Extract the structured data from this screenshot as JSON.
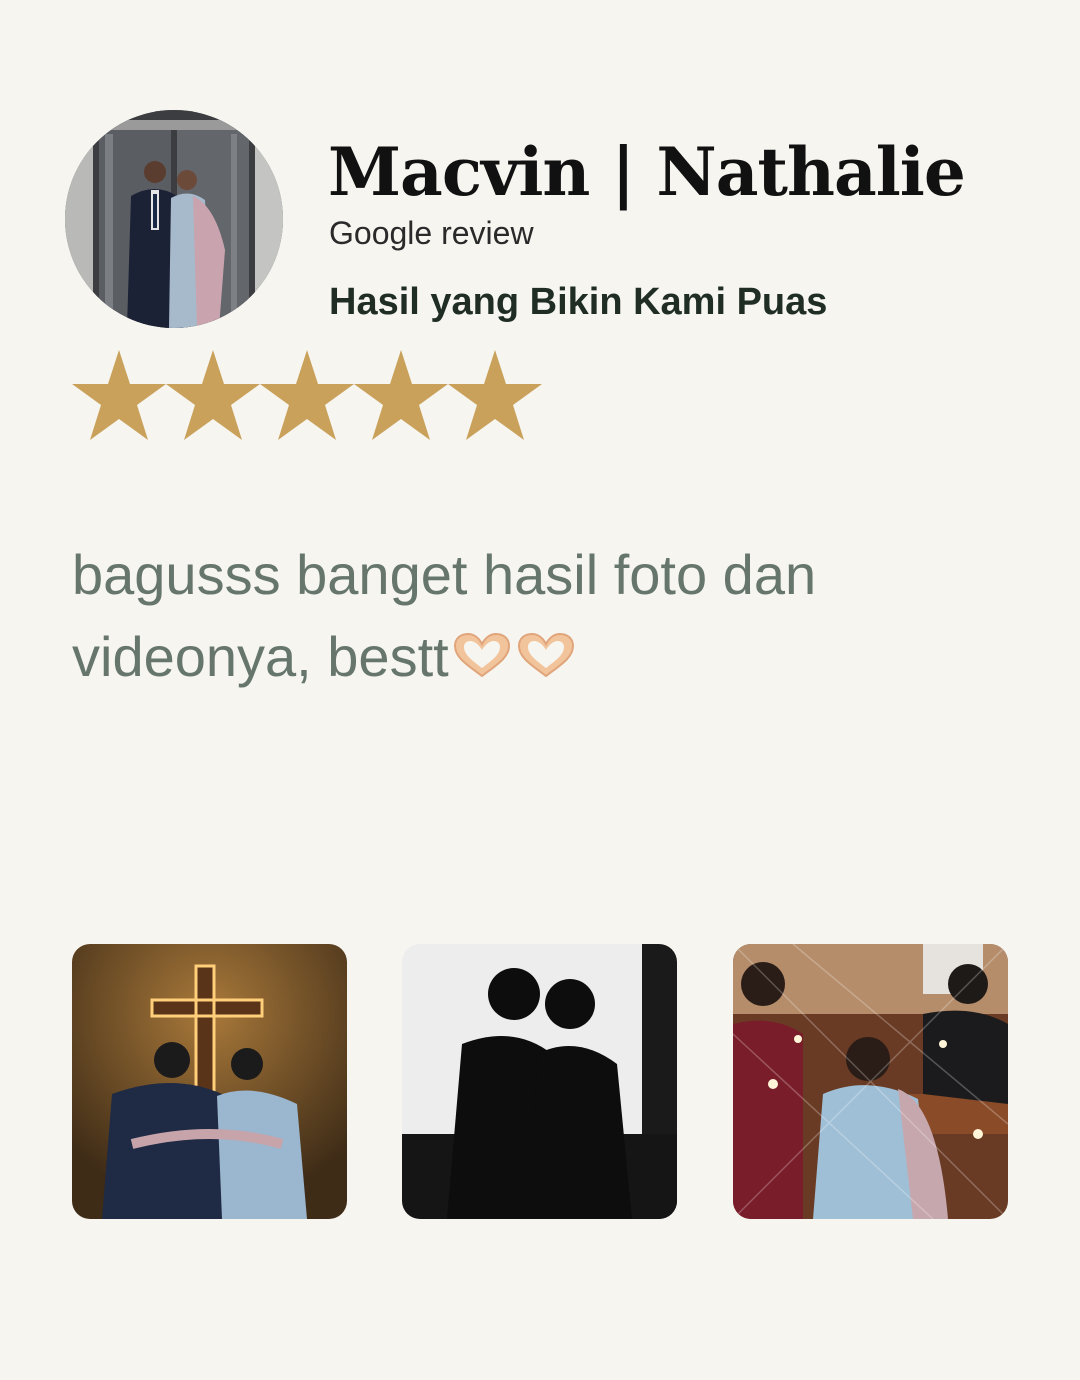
{
  "review": {
    "reviewer_name": "Macvin | Nathalie",
    "source": "Google review",
    "headline": "Hasil yang Bikin Kami Puas",
    "rating": 5,
    "rating_max": 5,
    "text": "bagusss banget hasil foto dan videonya, bestt",
    "emoji": "heart-hands-emoji",
    "star_color": "#c9a15a",
    "text_color": "#66766d"
  },
  "photos": [
    {
      "name": "couple-at-altar-cross-photo"
    },
    {
      "name": "couple-silhouette-window-photo"
    },
    {
      "name": "bride-with-guests-photo"
    }
  ]
}
